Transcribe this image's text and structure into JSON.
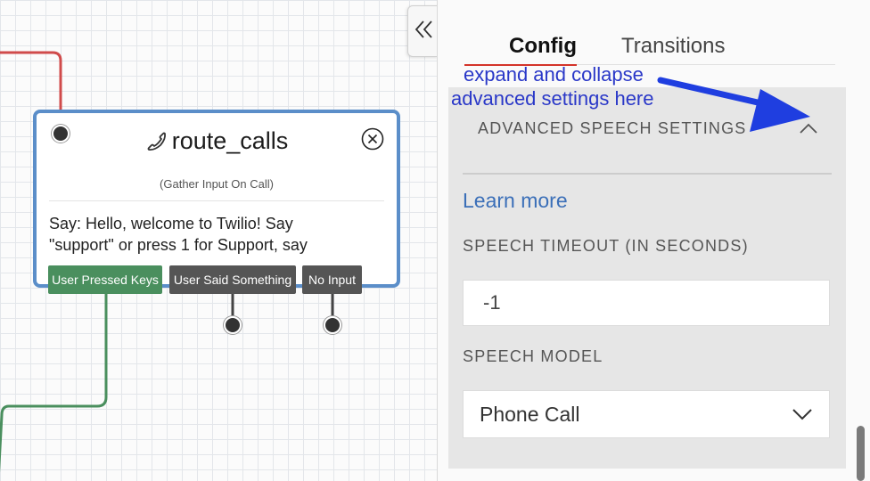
{
  "node": {
    "name": "route_calls",
    "type_label": "(Gather Input On Call)",
    "body": "Say: Hello, welcome to Twilio! Say\n\"support\" or press 1 for Support, say",
    "transitions": [
      {
        "label": "User Pressed Keys",
        "color": "#4a8f5e"
      },
      {
        "label": "User Said Something",
        "color": "#555555"
      },
      {
        "label": "No Input",
        "color": "#555555"
      }
    ]
  },
  "panel": {
    "tabs": [
      {
        "label": "Config",
        "active": true
      },
      {
        "label": "Transitions",
        "active": false
      }
    ],
    "annotation": {
      "line1": "expand and collapse",
      "line2": "advanced settings here"
    },
    "advanced": {
      "header": "ADVANCED SPEECH SETTINGS",
      "learn_more": "Learn more",
      "speech_timeout_label": "SPEECH TIMEOUT (IN SECONDS)",
      "speech_timeout_value": "-1",
      "speech_model_label": "SPEECH MODEL",
      "speech_model_value": "Phone Call"
    }
  },
  "colors": {
    "node_border": "#5b8ec9",
    "wire_red": "#d04b4b",
    "wire_green": "#4a8f5e",
    "annotation_blue": "#2a38c8",
    "tab_underline": "#d4332a",
    "link_blue": "#3b6fb8"
  },
  "icons": [
    "phone-icon",
    "close-circle-icon",
    "double-chevron-left-icon",
    "chevron-up-icon",
    "chevron-down-icon",
    "arrow-annotation"
  ]
}
